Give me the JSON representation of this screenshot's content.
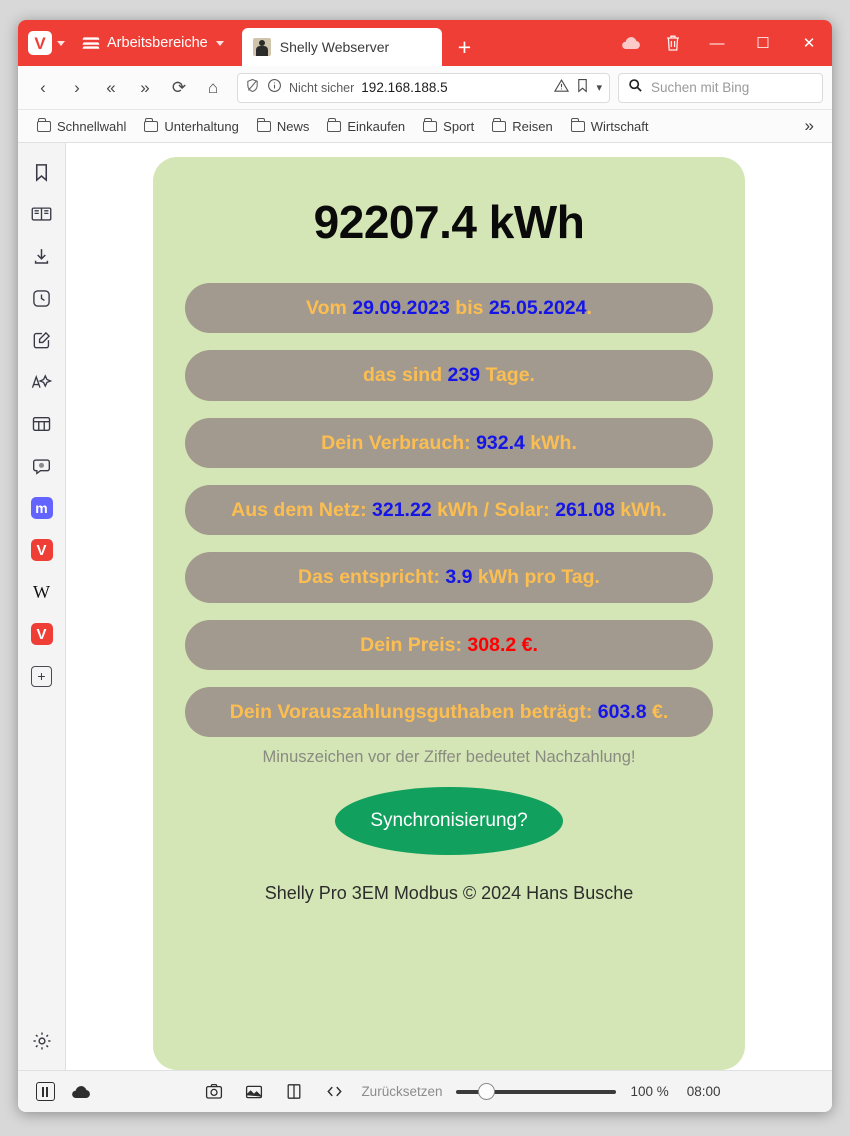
{
  "browser": {
    "tabbar": {
      "vivaldi_menu_label": "V",
      "workspaces_label": "Arbeitsbereiche",
      "tab_title": "Shelly Webserver",
      "newtab_label": "+",
      "sync_icon": "cloud-icon",
      "trash_icon": "trash-icon",
      "minimize_label": "—",
      "maximize_label": "☐",
      "close_label": "✕"
    },
    "addressbar": {
      "back_label": "‹",
      "forward_label": "›",
      "rewind_label": "«",
      "fastforward_label": "»",
      "reload_label": "⟳",
      "home_label": "⌂",
      "security_label": "Nicht sicher",
      "url": "192.168.188.5",
      "bookmark_icon": "bookmark-icon",
      "dropdown_label": "▾",
      "search_placeholder": "Suchen mit Bing"
    },
    "bookmarks": {
      "items": [
        {
          "label": "Schnellwahl"
        },
        {
          "label": "Unterhaltung"
        },
        {
          "label": "News"
        },
        {
          "label": "Einkaufen"
        },
        {
          "label": "Sport"
        },
        {
          "label": "Reisen"
        },
        {
          "label": "Wirtschaft"
        }
      ],
      "more_label": "»"
    },
    "sidebar": {
      "items": [
        {
          "name": "bookmarks-panel",
          "icon": "bookmark-icon"
        },
        {
          "name": "reading-list-panel",
          "icon": "book-icon"
        },
        {
          "name": "downloads-panel",
          "icon": "download-icon"
        },
        {
          "name": "history-panel",
          "icon": "clock-icon"
        },
        {
          "name": "notes-panel",
          "icon": "note-edit-icon"
        },
        {
          "name": "translate-panel",
          "icon": "translate-icon"
        },
        {
          "name": "window-panel",
          "icon": "window-icon"
        },
        {
          "name": "feed-panel",
          "icon": "feed-icon"
        },
        {
          "name": "mastodon-webpanel",
          "icon": "mastodon-icon",
          "label": "m"
        },
        {
          "name": "vivaldi-webpanel-1",
          "icon": "vivaldi-icon",
          "label": "V"
        },
        {
          "name": "wikipedia-webpanel",
          "icon": "wikipedia-icon",
          "label": "W"
        },
        {
          "name": "vivaldi-webpanel-2",
          "icon": "vivaldi-icon",
          "label": "V"
        },
        {
          "name": "add-webpanel",
          "icon": "plus-icon",
          "label": "+"
        }
      ],
      "settings_icon": "gear-icon"
    },
    "statusbar": {
      "pause_icon": "pause-icon",
      "cloud_icon": "cloud-icon",
      "capture_icon": "camera-icon",
      "image_icon": "image-icon",
      "tiling_icon": "tiling-icon",
      "devtools_icon": "code-icon",
      "reset_label": "Zurücksetzen",
      "zoom_level": "100 %",
      "clock": "08:00"
    }
  },
  "page": {
    "total_energy": "92207.4 kWh",
    "rows": [
      {
        "name": "date-range",
        "parts": [
          {
            "text": "Vom ",
            "color": "orange"
          },
          {
            "text": "29.09.2023",
            "color": "blue"
          },
          {
            "text": " bis ",
            "color": "orange"
          },
          {
            "text": "25.05.2024",
            "color": "blue"
          },
          {
            "text": ".",
            "color": "orange"
          }
        ]
      },
      {
        "name": "days-count",
        "parts": [
          {
            "text": "das sind ",
            "color": "orange"
          },
          {
            "text": "239",
            "color": "blue"
          },
          {
            "text": " Tage.",
            "color": "orange"
          }
        ]
      },
      {
        "name": "consumption",
        "parts": [
          {
            "text": "Dein Verbrauch: ",
            "color": "orange"
          },
          {
            "text": "932.4",
            "color": "blue"
          },
          {
            "text": " kWh.",
            "color": "orange"
          }
        ]
      },
      {
        "name": "grid-solar",
        "parts": [
          {
            "text": "Aus dem Netz: ",
            "color": "orange"
          },
          {
            "text": "321.22",
            "color": "blue"
          },
          {
            "text": " kWh / Solar: ",
            "color": "orange"
          },
          {
            "text": "261.08",
            "color": "blue"
          },
          {
            "text": " kWh.",
            "color": "orange"
          }
        ]
      },
      {
        "name": "daily-average",
        "parts": [
          {
            "text": "Das entspricht: ",
            "color": "orange"
          },
          {
            "text": "3.9",
            "color": "blue"
          },
          {
            "text": " kWh pro Tag.",
            "color": "orange"
          }
        ]
      },
      {
        "name": "price",
        "parts": [
          {
            "text": "Dein Preis: ",
            "color": "orange"
          },
          {
            "text": "308.2 €.",
            "color": "red"
          }
        ]
      },
      {
        "name": "prepayment-balance",
        "parts": [
          {
            "text": "Dein Vorauszahlungsguthaben beträgt: ",
            "color": "orange"
          },
          {
            "text": "603.8",
            "color": "blue"
          },
          {
            "text": " €.",
            "color": "orange"
          }
        ]
      }
    ],
    "note": "Minuszeichen vor der Ziffer bedeutet Nachzahlung!",
    "sync_button": "Synchronisierung?",
    "footer": "Shelly Pro 3EM Modbus © 2024 Hans Busche"
  },
  "colors": {
    "brand_red": "#EF3E36",
    "card_green": "#d4e6b5",
    "pill_gray": "#a29a8e",
    "label_orange": "#FDBE51",
    "value_blue": "#1515E8",
    "value_red": "#FF0000",
    "sync_green": "#11A05E"
  }
}
